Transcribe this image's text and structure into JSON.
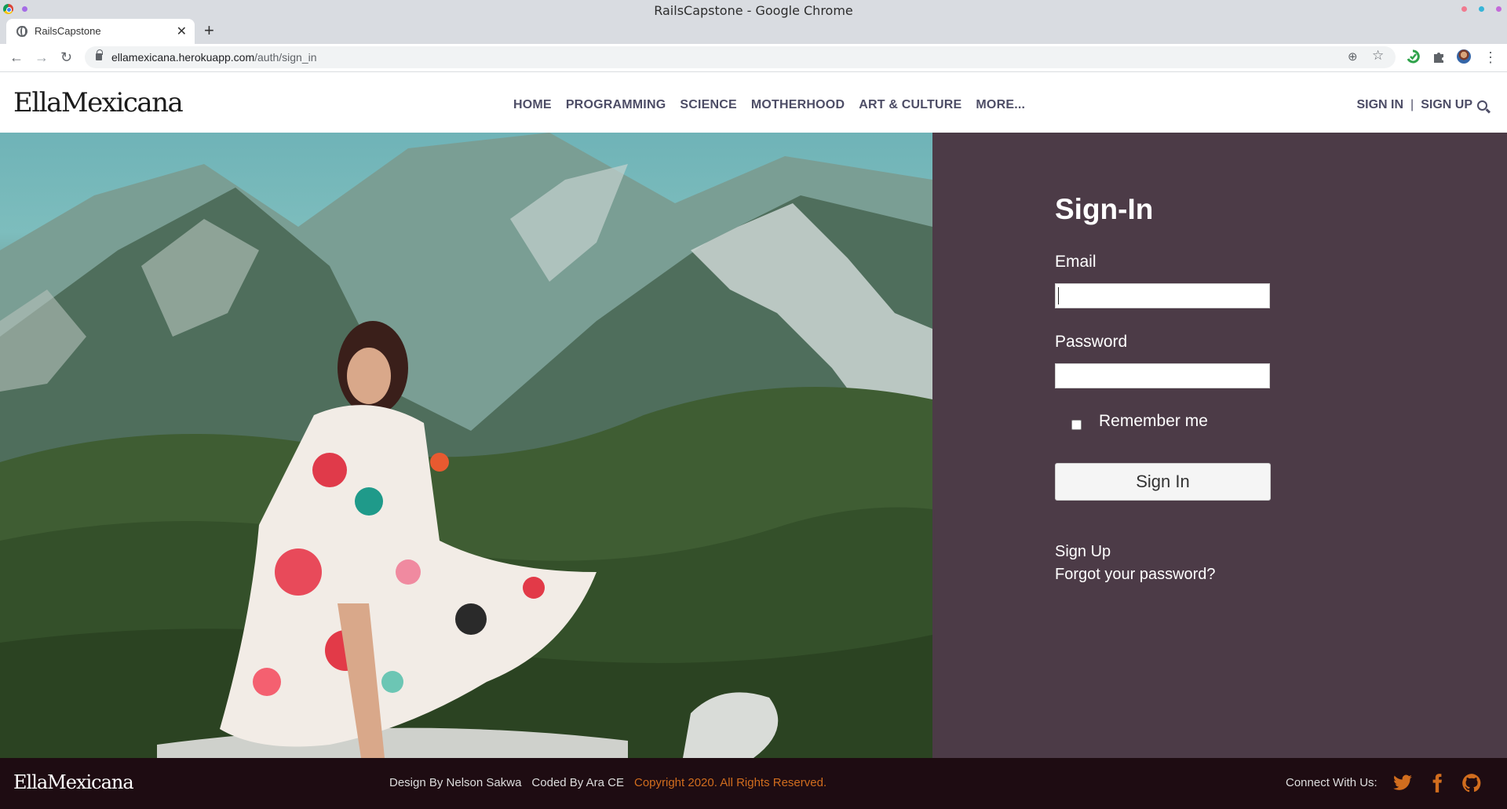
{
  "window": {
    "title": "RailsCapstone - Google Chrome"
  },
  "tab": {
    "title": "RailsCapstone",
    "close": "✕",
    "new_tab": "+"
  },
  "toolbar": {
    "back": "←",
    "forward": "→",
    "reload": "↻",
    "url_domain": "ellamexicana.herokuapp.com",
    "url_path": "/auth/sign_in",
    "zoom": "⊕",
    "star": "☆",
    "menu": "⋮"
  },
  "header": {
    "logo": "EllaMexicana",
    "nav": [
      "HOME",
      "PROGRAMMING",
      "SCIENCE",
      "MOTHERHOOD",
      "ART & CULTURE",
      "MORE..."
    ],
    "sign_in": "SIGN IN",
    "separator": "|",
    "sign_up": "SIGN UP"
  },
  "form": {
    "title": "Sign-In",
    "email_label": "Email",
    "email_value": "",
    "password_label": "Password",
    "password_value": "",
    "remember_label": "Remember me",
    "remember_checked": false,
    "submit_label": "Sign In",
    "signup_link": "Sign Up",
    "forgot_link": "Forgot your password?"
  },
  "footer": {
    "logo": "EllaMexicana",
    "design_credit": "Design By Nelson Sakwa",
    "code_credit": "Coded By Ara CE",
    "copyright": "Copyright 2020. All Rights Reserved.",
    "connect": "Connect With Us:",
    "social": [
      "twitter-icon",
      "facebook-icon",
      "github-icon"
    ]
  },
  "colors": {
    "panel": "#4c3b47",
    "footer": "#1e0c12",
    "accent": "#d16d1e",
    "nav_text": "#4d4d66"
  }
}
